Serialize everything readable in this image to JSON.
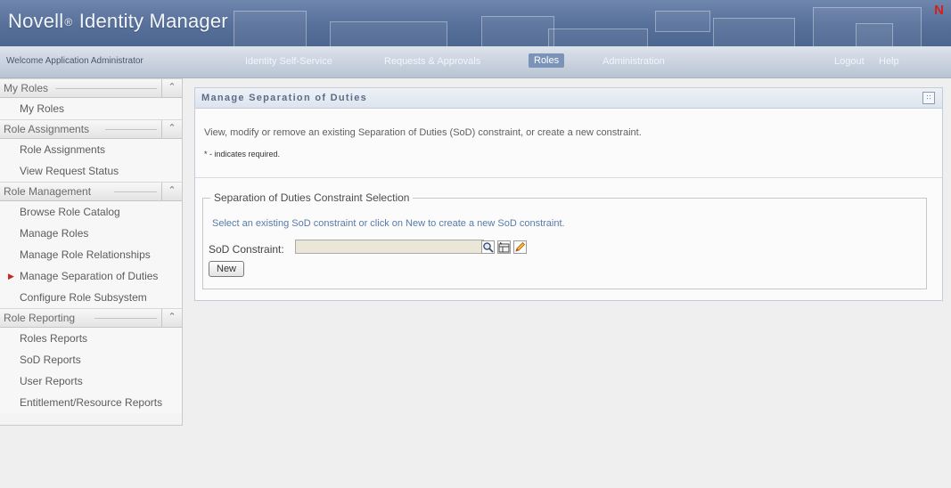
{
  "header": {
    "brand_name": "Novell",
    "brand_reg": "®",
    "brand_product": " Identity Manager",
    "logo_letter": "N",
    "logo_color": "#d4201d"
  },
  "nav": {
    "welcome": "Welcome Application Administrator",
    "tabs": [
      {
        "label": "Identity Self-Service",
        "active": false
      },
      {
        "label": "Requests & Approvals",
        "active": false
      },
      {
        "label": "Roles",
        "active": true
      },
      {
        "label": "Administration",
        "active": false
      }
    ],
    "logout": "Logout",
    "help": "Help"
  },
  "sidebar": {
    "collapse_icon": "double-chevron-up-icon",
    "sections": [
      {
        "title": "My Roles",
        "items": [
          "My Roles"
        ]
      },
      {
        "title": "Role Assignments",
        "items": [
          "Role Assignments",
          "View Request Status"
        ]
      },
      {
        "title": "Role Management",
        "items": [
          "Browse Role Catalog",
          "Manage Roles",
          "Manage Role Relationships",
          "Manage Separation of Duties",
          "Configure Role Subsystem"
        ]
      },
      {
        "title": "Role Reporting",
        "items": [
          "Roles Reports",
          "SoD Reports",
          "User Reports",
          "Entitlement/Resource Reports"
        ]
      }
    ],
    "current_item": "Manage Separation of Duties",
    "marker_color": "#c32a1e"
  },
  "main": {
    "title": "Manage Separation of Duties",
    "description": "View, modify or remove an existing Separation of Duties (SoD) constraint, or create a new constraint.",
    "required_note": "* - indicates required.",
    "fieldset": {
      "legend": "Separation of Duties Constraint Selection",
      "hint": "Select an existing SoD constraint or click on New to create a new SoD constraint.",
      "field_label": "SoD Constraint:",
      "field_value": "",
      "icons": [
        "search-icon",
        "history-icon",
        "edit-icon"
      ],
      "new_button": "New"
    }
  }
}
